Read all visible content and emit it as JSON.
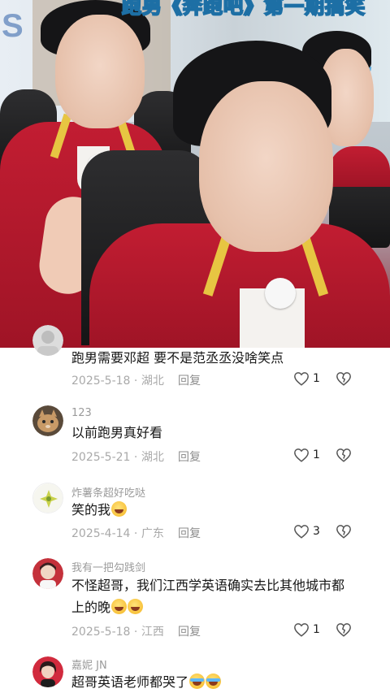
{
  "video": {
    "caption": "跑男《奔跑吧》第一期搞笑",
    "left_sign": "S",
    "right_sign": "跑"
  },
  "comments": [
    {
      "username": "",
      "text": "跑男需要邓超 要不是范丞丞没啥笑点",
      "date": "2025-5-18",
      "location": "湖北",
      "reply_label": "回复",
      "likes": "1"
    },
    {
      "username": "123",
      "text": "以前跑男真好看",
      "date": "2025-5-21",
      "location": "湖北",
      "reply_label": "回复",
      "likes": "1"
    },
    {
      "username": "炸薯条超好吃哒",
      "text": "笑的我",
      "date": "2025-4-14",
      "location": "广东",
      "reply_label": "回复",
      "likes": "3"
    },
    {
      "username": "我有一把勾践剑",
      "text": "不怪超哥，我们江西学英语确实去比其他城市都上的晚",
      "date": "2025-5-18",
      "location": "江西",
      "reply_label": "回复",
      "likes": "1"
    },
    {
      "username": "嘉妮 JN",
      "text": "超哥英语老师都哭了",
      "date": "",
      "location": "",
      "reply_label": "",
      "likes": ""
    }
  ],
  "colors": {
    "jacket_red": "#c21d32",
    "caption_blue": "#1d6fa5",
    "text_dark": "#161616",
    "meta_gray": "#a9a9a9"
  }
}
